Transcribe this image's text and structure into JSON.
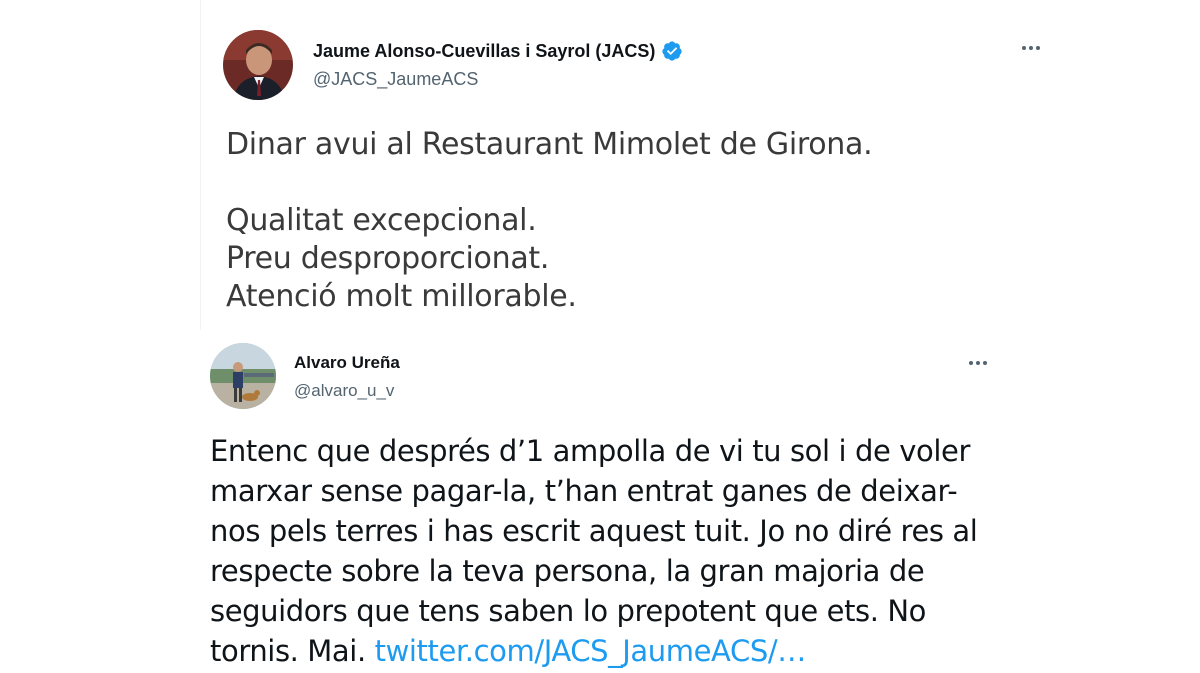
{
  "colors": {
    "link": "#1d9bf0",
    "verified": "#1d9bf0",
    "secondary_text": "#536471",
    "primary_text": "#0f1419"
  },
  "tweet1": {
    "name": "Jaume Alonso-Cuevillas i Sayrol (JACS)",
    "handle": "@JACS_JaumeACS",
    "verified_icon": "verified-badge-icon",
    "more_icon": "more-horizontal-icon",
    "body": {
      "line1": "Dinar avui al Restaurant Mimolet de Girona.",
      "line2": "Qualitat excepcional.",
      "line3": "Preu desproporcionat.",
      "line4": "Atenció molt millorable."
    }
  },
  "tweet2": {
    "name": "Alvaro Ureña",
    "handle": "@alvaro_u_v",
    "more_icon": "more-horizontal-icon",
    "body": {
      "line1": "Entenc que després d’1 ampolla de vi tu sol i de voler",
      "line2": "marxar sense pagar-la, t’han entrat ganes de deixar-",
      "line3": "nos pels terres i has escrit aquest tuit. Jo no diré res al",
      "line4": "respecte sobre la teva persona, la gran majoria de",
      "line5": "seguidors que tens saben lo prepotent que ets. No",
      "line6_text": "tornis. Mai. ",
      "line6_link": "twitter.com/JACS_JaumeACS/…"
    }
  }
}
